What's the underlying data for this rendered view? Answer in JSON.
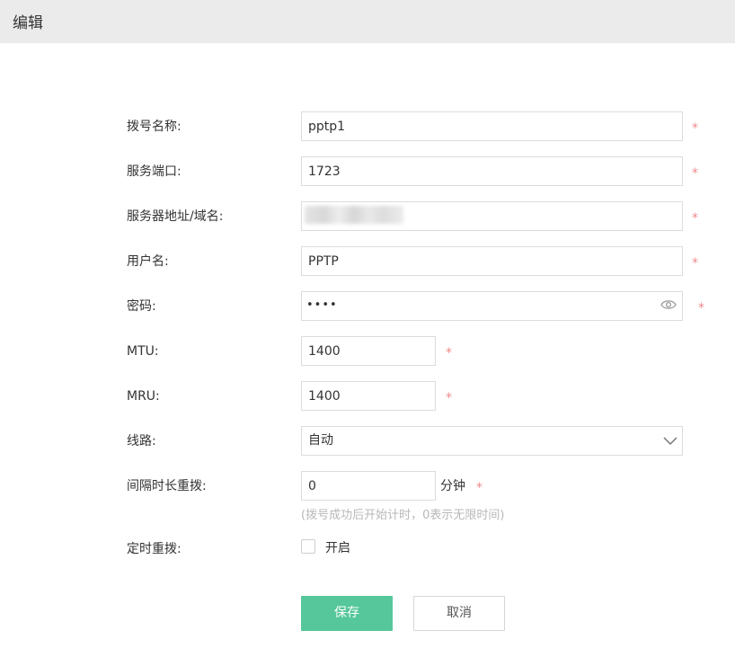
{
  "header": {
    "title": "编辑"
  },
  "form": {
    "dial_name": {
      "label": "拨号名称:",
      "value": "pptp1"
    },
    "server_port": {
      "label": "服务端口:",
      "value": "1723"
    },
    "server_address": {
      "label": "服务器地址/域名:",
      "value": ""
    },
    "username": {
      "label": "用户名:",
      "value": "PPTP"
    },
    "password": {
      "label": "密码:",
      "value": "••••",
      "icon": "eye-icon"
    },
    "mtu": {
      "label": "MTU:",
      "value": "1400"
    },
    "mru": {
      "label": "MRU:",
      "value": "1400"
    },
    "line": {
      "label": "线路:",
      "selected": "自动",
      "icon": "chevron-down-icon"
    },
    "redial_interval": {
      "label": "间隔时长重拨:",
      "value": "0",
      "unit": "分钟",
      "hint": "(拨号成功后开始计时，0表示无限时间)"
    },
    "scheduled_redial": {
      "label": "定时重拨:",
      "checkbox_label": "开启",
      "checked": false
    },
    "required_mark": "*"
  },
  "buttons": {
    "save": "保存",
    "cancel": "取消"
  },
  "colors": {
    "accent": "#55c79a",
    "required": "#f08a8a",
    "header_bg": "#ebebeb"
  }
}
